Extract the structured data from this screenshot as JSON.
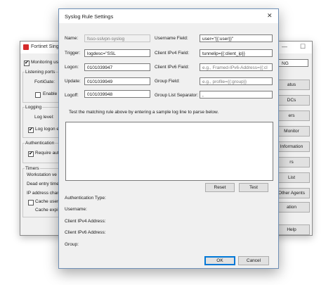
{
  "background_window": {
    "title": "Fortinet Singl",
    "minimize_glyph": "—",
    "maximize_glyph": "☐",
    "monitoring_label": "Monitoring us",
    "listening_ports_label": "Listening ports",
    "fortigate_label": "FortiGate:",
    "enable_label": "Enable",
    "logging_label": "Logging",
    "log_level_label": "Log level:",
    "log_logon_label": "Log logon e",
    "authentication_label": "Authentication",
    "require_auth_label": "Require aut",
    "timers_label": "Timers",
    "workstation_label": "Workstation ve",
    "dead_entry_label": "Dead entry time",
    "ip_address_label": "IP address chan",
    "cache_user_label": "Cache user",
    "cache_expire_label": "Cache expi",
    "top_value": "NG",
    "right_buttons": [
      "atus",
      "DCs",
      "ers",
      "Monitor",
      "Information",
      "rs",
      "List",
      "Other Agents",
      "ation"
    ],
    "help_label": "Help"
  },
  "dialog": {
    "title": "Syslog Rule Settings",
    "close_glyph": "✕",
    "left_fields": [
      {
        "label": "Name:",
        "value": "fsso-sslvpn-syslog",
        "disabled": true
      },
      {
        "label": "Trigger:",
        "value": "logdesc=\"SSL",
        "disabled": false
      },
      {
        "label": "Logon:",
        "value": "0101039947",
        "disabled": false
      },
      {
        "label": "Update:",
        "value": "0101039949",
        "disabled": false
      },
      {
        "label": "Logoff:",
        "value": "0101039948",
        "disabled": false
      }
    ],
    "right_fields": [
      {
        "label": "Username Field:",
        "value": "user=\"{{:user}}\"",
        "placeholder": ""
      },
      {
        "label": "Client IPv4 Field:",
        "value": "tunnelip={{:client_ip}}",
        "placeholder": ""
      },
      {
        "label": "Client IPv6 Field:",
        "value": "",
        "placeholder": "e.g., Framed-IPv6-Address={{:cl"
      },
      {
        "label": "Group Field:",
        "value": "",
        "placeholder": "e.g., profile={{:group}}"
      },
      {
        "label": "Group List Separator:",
        "value": ",",
        "placeholder": ""
      }
    ],
    "test_instruction": "Test the matching rule above by entering a sample log line to parse below.",
    "reset_label": "Reset",
    "test_label": "Test",
    "result_labels": [
      "Authentication Type:",
      "Username:",
      "Client IPv4 Address:",
      "Client IPv6 Address:",
      "Group:"
    ],
    "ok_label": "OK",
    "cancel_label": "Cancel"
  }
}
